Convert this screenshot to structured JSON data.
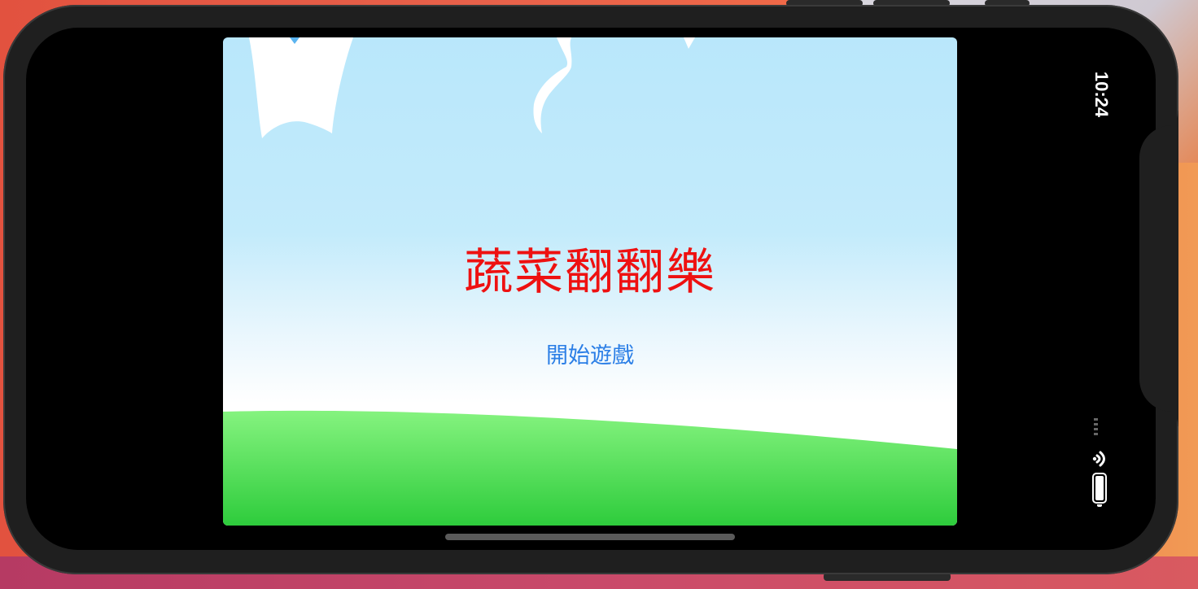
{
  "status_bar": {
    "time": "10:24"
  },
  "game": {
    "title": "蔬菜翻翻樂",
    "start_label": "開始遊戲"
  },
  "colors": {
    "title": "#ee1111",
    "start_button": "#2a7ee6",
    "sky_top": "#b9e7fb",
    "grass_top": "#85f37f",
    "grass_bottom": "#2ecc3c"
  },
  "icons": [
    "wifi-icon",
    "battery-icon",
    "cellular-signal-icon"
  ]
}
